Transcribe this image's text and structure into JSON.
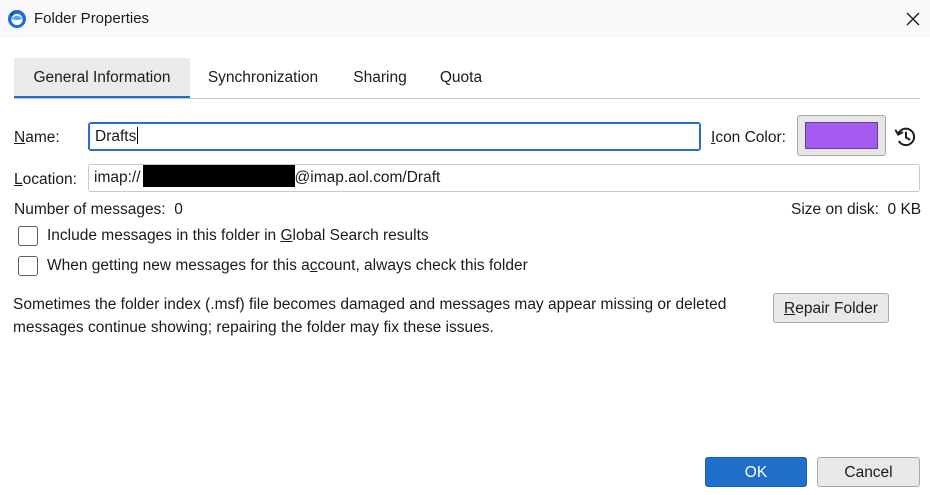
{
  "window": {
    "title": "Folder Properties"
  },
  "tabs": [
    {
      "label": "General Information",
      "selected": true
    },
    {
      "label": "Synchronization",
      "selected": false
    },
    {
      "label": "Sharing",
      "selected": false
    },
    {
      "label": "Quota",
      "selected": false
    }
  ],
  "form": {
    "name_label_accel": "N",
    "name_label_rest": "ame:",
    "name_value": "Drafts",
    "icon_color_label_accel": "I",
    "icon_color_label_rest": "con Color:",
    "icon_color_value": "#a55bf0",
    "location_label_accel": "L",
    "location_label_rest": "ocation:",
    "location_prefix": "imap://",
    "location_suffix": "@imap.aol.com/Draft",
    "messages_label": "Number of messages:",
    "messages_value": "0",
    "size_label": "Size on disk:",
    "size_value": "0 KB"
  },
  "checkboxes": {
    "global_search": {
      "text_before": "Include messages in this folder in ",
      "accel": "G",
      "text_after": "lobal Search results",
      "checked": false
    },
    "check_folder": {
      "text_before": "When getting new messages for this a",
      "accel": "c",
      "text_after": "count, always check this folder",
      "checked": false
    }
  },
  "repair": {
    "text": "Sometimes the folder index (.msf) file becomes damaged and messages may appear missing or deleted messages continue showing; repairing the folder may fix these issues.",
    "button_accel": "R",
    "button_rest": "epair Folder"
  },
  "footer": {
    "ok_label": "OK",
    "cancel_label": "Cancel"
  },
  "colors": {
    "accent": "#1f6ec9",
    "icon_color": "#a55bf0"
  },
  "icons": {
    "app": "thunderbird-icon",
    "close": "close-icon",
    "reset": "reset-color-icon"
  }
}
